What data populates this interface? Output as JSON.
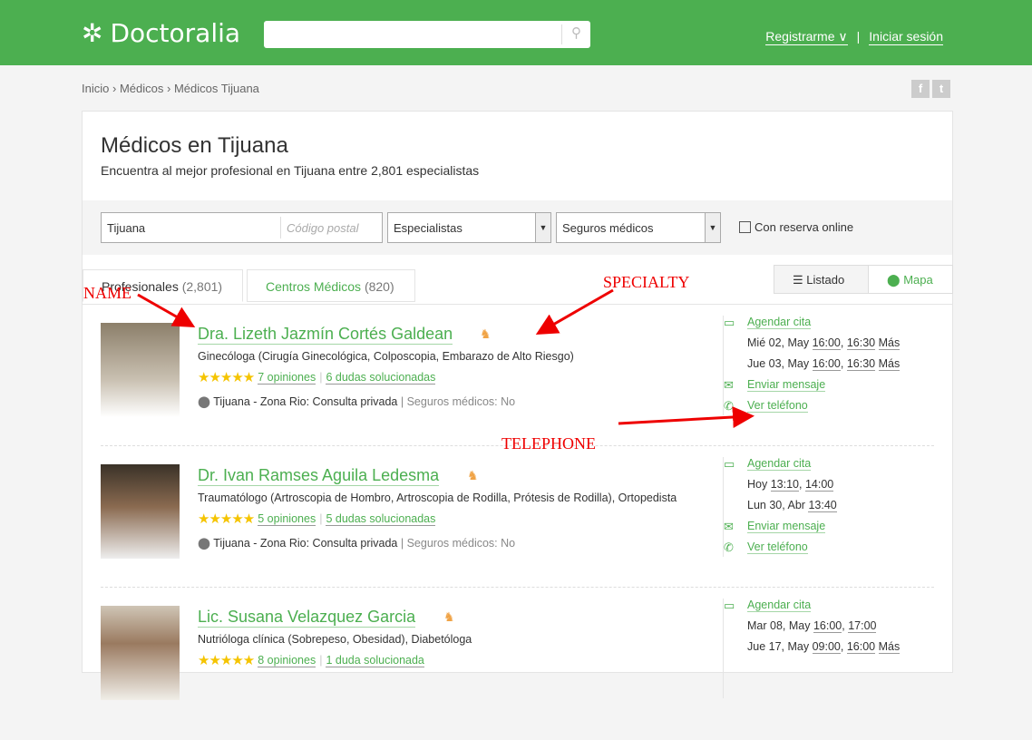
{
  "header": {
    "logo": "Doctoralia",
    "register": "Registrarme ∨",
    "login": "Iniciar sesión"
  },
  "breadcrumb": [
    "Inicio",
    "›",
    "Médicos",
    "›",
    "Médicos Tijuana"
  ],
  "page": {
    "title": "Médicos en Tijuana",
    "subtitle": "Encuentra al mejor profesional en Tijuana entre 2,801 especialistas"
  },
  "filters": {
    "city": "Tijuana",
    "postal_placeholder": "Código postal",
    "specialty": "Especialistas",
    "insurance": "Seguros médicos",
    "online": "Con reserva online"
  },
  "tabs": {
    "professionals": "Profesionales",
    "professionals_count": "(2,801)",
    "centers": "Centros Médicos",
    "centers_count": "(820)",
    "list": "Listado",
    "map": "Mapa"
  },
  "doctors": [
    {
      "name": "Dra. Lizeth Jazmín Cortés Galdean",
      "specialty": "Ginecóloga (Cirugía Ginecológica, Colposcopia, Embarazo de Alto Riesgo)",
      "opinions": "7 opiniones",
      "questions": "6 dudas solucionadas",
      "location": "Tijuana - Zona Rio: Consulta privada",
      "insurance": "Seguros médicos: No",
      "book": "Agendar cita",
      "slot1_day": "Mié 02, May",
      "slot1_times": [
        "16:00",
        "16:30",
        "Más"
      ],
      "slot2_day": "Jue 03, May",
      "slot2_times": [
        "16:00",
        "16:30",
        "Más"
      ],
      "message": "Enviar mensaje",
      "phone": "Ver teléfono"
    },
    {
      "name": "Dr. Ivan Ramses Aguila Ledesma",
      "specialty": "Traumatólogo (Artroscopia de Hombro, Artroscopia de Rodilla, Prótesis de Rodilla), Ortopedista",
      "opinions": "5 opiniones",
      "questions": "5 dudas solucionadas",
      "location": "Tijuana - Zona Rio: Consulta privada",
      "insurance": "Seguros médicos: No",
      "book": "Agendar cita",
      "slot1_day": "Hoy",
      "slot1_times": [
        "13:10",
        "14:00"
      ],
      "slot2_day": "Lun 30, Abr",
      "slot2_times": [
        "13:40"
      ],
      "message": "Enviar mensaje",
      "phone": "Ver teléfono"
    },
    {
      "name": "Lic. Susana Velazquez Garcia",
      "specialty": "Nutrióloga clínica (Sobrepeso, Obesidad), Diabetóloga",
      "opinions": "8 opiniones",
      "questions": "1 duda solucionada",
      "book": "Agendar cita",
      "slot1_day": "Mar 08, May",
      "slot1_times": [
        "16:00",
        "17:00"
      ],
      "slot2_day": "Jue 17, May",
      "slot2_times": [
        "09:00",
        "16:00",
        "Más"
      ]
    }
  ],
  "annotations": {
    "name": "NAME",
    "specialty": "SPECIALTY",
    "telephone": "TELEPHONE"
  }
}
